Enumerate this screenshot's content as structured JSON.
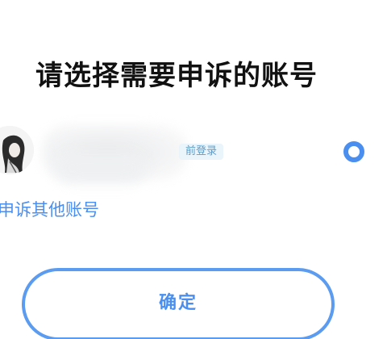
{
  "page": {
    "title": "请选择需要申诉的账号"
  },
  "account": {
    "badge": "前登录",
    "selected": true
  },
  "other_account_link": "申诉其他账号",
  "confirm_button": {
    "label": "确定"
  },
  "colors": {
    "accent": "#4a8ff0",
    "badge_bg": "#eaf4fb",
    "badge_text": "#5f9cc8",
    "title": "#111111"
  },
  "icons": {
    "radio": "radio-selected-icon",
    "avatar": "avatar-image"
  }
}
